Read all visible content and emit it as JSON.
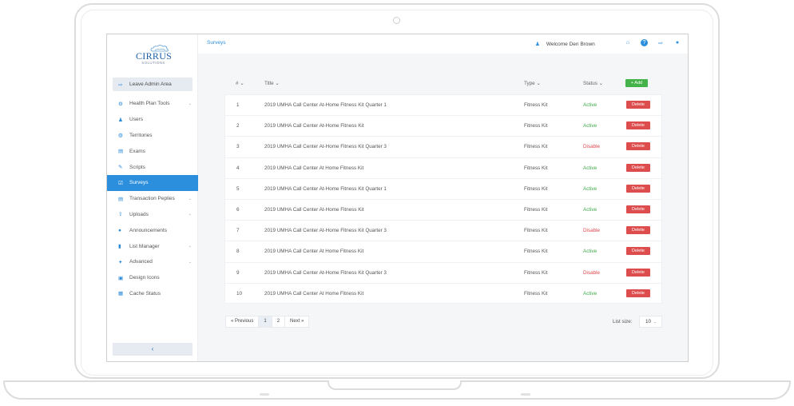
{
  "logo": {
    "name": "CIRRUS",
    "sub": "SOLUTIONS"
  },
  "sidebar": {
    "leave_label": "Leave Admin Area",
    "items": [
      {
        "label": "Health Plan Tools",
        "icon": "gear-icon",
        "glyph": "⚙",
        "chevron": true
      },
      {
        "label": "Users",
        "icon": "user-icon",
        "glyph": "♟",
        "chevron": false
      },
      {
        "label": "Territories",
        "icon": "globe-icon",
        "glyph": "◍",
        "chevron": false
      },
      {
        "label": "Exams",
        "icon": "list-icon",
        "glyph": "▤",
        "chevron": false
      },
      {
        "label": "Scripts",
        "icon": "pen-icon",
        "glyph": "✎",
        "chevron": false
      },
      {
        "label": "Surveys",
        "icon": "survey-icon",
        "glyph": "☑",
        "chevron": false,
        "active": true
      },
      {
        "label": "Transaction Peplies",
        "icon": "list-icon",
        "glyph": "▤",
        "chevron": true
      },
      {
        "label": "Uploads",
        "icon": "upload-icon",
        "glyph": "⇪",
        "chevron": true
      },
      {
        "label": "Announcements",
        "icon": "info-icon",
        "glyph": "●",
        "chevron": false
      },
      {
        "label": "List Manager",
        "icon": "book-icon",
        "glyph": "▮",
        "chevron": true
      },
      {
        "label": "Advanced",
        "icon": "star-icon",
        "glyph": "✦",
        "chevron": true
      },
      {
        "label": "Design Icons",
        "icon": "image-icon",
        "glyph": "▣",
        "chevron": false
      },
      {
        "label": "Cache Status",
        "icon": "cache-icon",
        "glyph": "▦",
        "chevron": false
      }
    ],
    "collapse_label": "‹"
  },
  "topbar": {
    "breadcrumb": "Surveys",
    "welcome": "Welcome Den Brown"
  },
  "table": {
    "headers": {
      "num": "# ⌄",
      "title": "Title ⌄",
      "type": "Type ⌄",
      "status": "Status ⌄"
    },
    "add_label": "+ Add",
    "delete_label": "Delete",
    "rows": [
      {
        "num": "1",
        "title": "2019 UMHA Call Center At-Home Fitness Kit Quarter 1",
        "type": "Fitness Kit",
        "status": "Active"
      },
      {
        "num": "2",
        "title": "2019 UMHA Call Center At-Home Fitness Kit",
        "type": "Fitness Kit",
        "status": "Active"
      },
      {
        "num": "3",
        "title": "2019 UMHA Call Center At-Home Fitness Kit Quarter 3",
        "type": "Fitness Kit",
        "status": "Disable"
      },
      {
        "num": "4",
        "title": "2019 UMHA Call Center At Home Fitness Kit",
        "type": "Fitness Kit",
        "status": "Active"
      },
      {
        "num": "5",
        "title": "2019 UMHA Call Center At-Home Fitness Kit Quarter 1",
        "type": "Fitness Kit",
        "status": "Active"
      },
      {
        "num": "6",
        "title": "2019 UMHA Call Center At-Home Fitness Kit",
        "type": "Fitness Kit",
        "status": "Active"
      },
      {
        "num": "7",
        "title": "2019 UMHA Call Center At-Home Fitness Kit Quarter 3",
        "type": "Fitness Kit",
        "status": "Disable"
      },
      {
        "num": "8",
        "title": "2019 UMHA Call Center At Home Fitness Kit",
        "type": "Fitness Kit",
        "status": "Active"
      },
      {
        "num": "9",
        "title": "2019 UMHA Call Center At-Home Fitness Kit Quarter 3",
        "type": "Fitness Kit",
        "status": "Disable"
      },
      {
        "num": "10",
        "title": "2019 UMHA Call Center At Home Fitness Kit",
        "type": "Fitness Kit",
        "status": "Active"
      }
    ]
  },
  "pagination": {
    "prev": "« Previous",
    "pages": [
      "1",
      "2"
    ],
    "current": "1",
    "next": "Next »",
    "list_size_label": "List size:",
    "list_size_value": "10"
  },
  "colors": {
    "accent": "#2b8fdd",
    "active": "#3fa84a",
    "disable": "#e0474c",
    "delete": "#de4d4d",
    "add": "#45b34a"
  }
}
